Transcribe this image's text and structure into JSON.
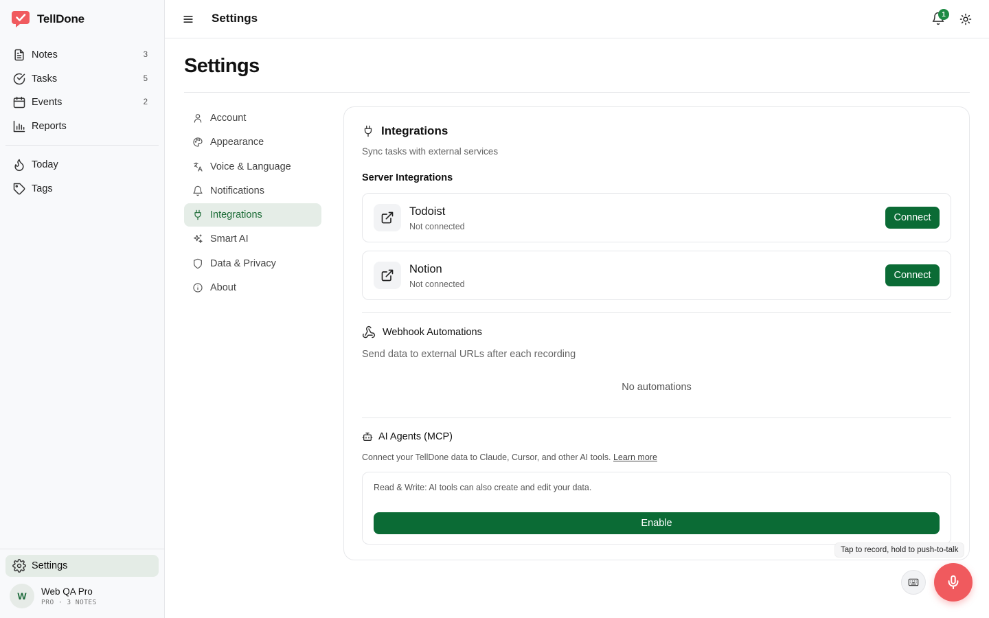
{
  "app": {
    "name": "TellDone"
  },
  "sidebar": {
    "items": [
      {
        "label": "Notes",
        "count": "3",
        "icon": "file-text-icon"
      },
      {
        "label": "Tasks",
        "count": "5",
        "icon": "check-circle-icon"
      },
      {
        "label": "Events",
        "count": "2",
        "icon": "calendar-icon"
      },
      {
        "label": "Reports",
        "count": "",
        "icon": "bar-chart-icon"
      }
    ],
    "secondary": [
      {
        "label": "Today",
        "icon": "flame-icon"
      },
      {
        "label": "Tags",
        "icon": "tag-icon"
      }
    ],
    "settings_label": "Settings",
    "user": {
      "initial": "W",
      "name": "Web QA Pro",
      "meta": "PRO · 3 NOTES"
    }
  },
  "topbar": {
    "title": "Settings",
    "notification_count": "1"
  },
  "page": {
    "title": "Settings"
  },
  "settings_nav": [
    {
      "label": "Account",
      "icon": "user-icon"
    },
    {
      "label": "Appearance",
      "icon": "palette-icon"
    },
    {
      "label": "Voice & Language",
      "icon": "languages-icon"
    },
    {
      "label": "Notifications",
      "icon": "bell-icon"
    },
    {
      "label": "Integrations",
      "icon": "plug-icon",
      "active": true
    },
    {
      "label": "Smart AI",
      "icon": "sparkles-icon"
    },
    {
      "label": "Data & Privacy",
      "icon": "shield-icon"
    },
    {
      "label": "About",
      "icon": "info-icon"
    }
  ],
  "integrations": {
    "title": "Integrations",
    "subtitle": "Sync tasks with external services",
    "server_heading": "Server Integrations",
    "services": [
      {
        "name": "Todoist",
        "status": "Not connected",
        "button": "Connect"
      },
      {
        "name": "Notion",
        "status": "Not connected",
        "button": "Connect"
      }
    ],
    "webhooks": {
      "title": "Webhook Automations",
      "subtitle": "Send data to external URLs after each recording",
      "empty": "No automations"
    },
    "mcp": {
      "title": "AI Agents (MCP)",
      "description": "Connect your TellDone data to Claude, Cursor, and other AI tools.",
      "learn_more": "Learn more",
      "note": "Read & Write: AI tools can also create and edit your data.",
      "button": "Enable"
    }
  },
  "floating": {
    "tooltip": "Tap to record, hold to push-to-talk"
  },
  "colors": {
    "brand": "#0b6b35",
    "accent_red": "#f05a5e",
    "active_bg": "#e5ede7"
  }
}
